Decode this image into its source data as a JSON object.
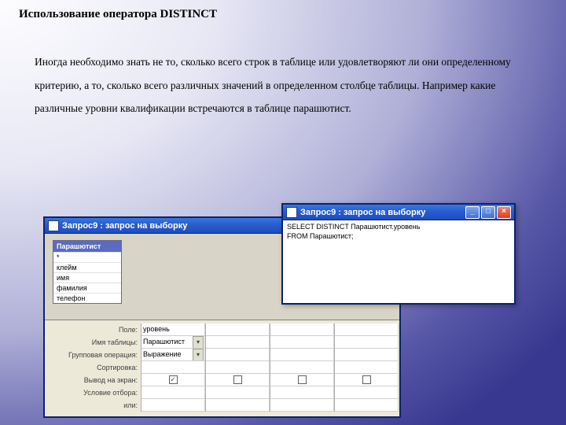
{
  "heading": "Использование оператора DISTINCT",
  "body": "Иногда необходимо знать не то, сколько всего строк в таблице или удовлетворяют ли они определенному критерию, а то, сколько всего различных значений в определенном столбце таблицы. Например какие различные уровни квалификации встречаются в таблице парашютист.",
  "win1": {
    "title": "Запрос9 : запрос на выборку",
    "table": {
      "name": "Парашютист",
      "fields": [
        "*",
        "клейм",
        "имя",
        "фамилия",
        "телефон"
      ]
    },
    "grid": {
      "labels": [
        "Поле:",
        "Имя таблицы:",
        "Групповая операция:",
        "Сортировка:",
        "Вывод на экран:",
        "Условие отбора:",
        "или:"
      ],
      "col0": {
        "field": "уровень",
        "table": "Парашютист",
        "op": "Выражение",
        "show": true
      }
    }
  },
  "win2": {
    "title": "Запрос9 : запрос на выборку",
    "sql1": "SELECT DISTINCT Парашютист.уровень",
    "sql2": "FROM Парашютист;"
  }
}
